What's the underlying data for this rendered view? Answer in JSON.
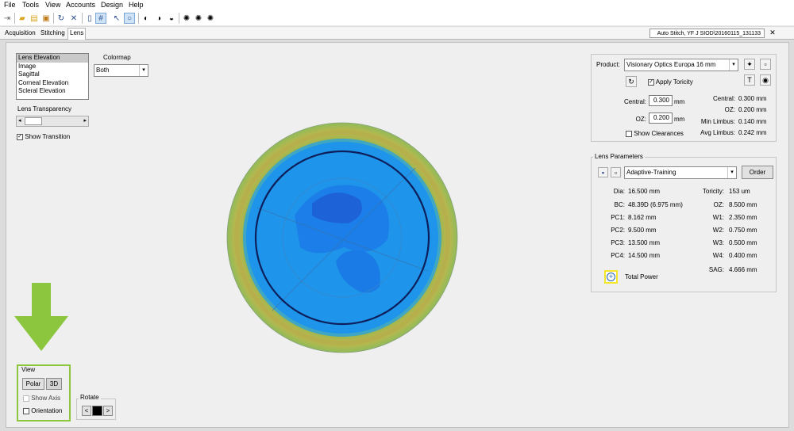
{
  "menu": [
    "File",
    "Tools",
    "View",
    "Accounts",
    "Design",
    "Help"
  ],
  "tabs": [
    "Acquisition",
    "Stitching",
    "Lens"
  ],
  "file_tab": "Auto Stitch, YF J SIOD\\20160115_131133",
  "display_list": [
    "Lens Elevation",
    "Image",
    "Sagittal",
    "Corneal Elevation",
    "Scleral Elevation"
  ],
  "colormap": {
    "label": "Colormap",
    "value": "Both"
  },
  "transparency_label": "Lens Transparency",
  "show_transition": "Show Transition",
  "product": {
    "label": "Product:",
    "value": "Visionary Optics Europa 16 mm",
    "apply_toricity": "Apply Toricity",
    "central_label": "Central:",
    "central_value": "0.300",
    "oz_label": "OZ:",
    "oz_value": "0.200",
    "unit": "mm",
    "show_clearances": "Show Clearances",
    "stats": [
      {
        "label": "Central:",
        "value": "0.300 mm"
      },
      {
        "label": "OZ:",
        "value": "0.200 mm"
      },
      {
        "label": "Min Limbus:",
        "value": "0.140 mm"
      },
      {
        "label": "Avg Limbus:",
        "value": "0.242 mm"
      }
    ]
  },
  "lens_params": {
    "title": "Lens Parameters",
    "design": "Adaptive-Training",
    "order": "Order",
    "left": [
      {
        "label": "Dia:",
        "value": "16.500 mm"
      },
      {
        "label": "BC:",
        "value": "48.39D (6.975 mm)"
      },
      {
        "label": "PC1:",
        "value": "8.162 mm"
      },
      {
        "label": "PC2:",
        "value": "9.500 mm"
      },
      {
        "label": "PC3:",
        "value": "13.500 mm"
      },
      {
        "label": "PC4:",
        "value": "14.500 mm"
      }
    ],
    "right": [
      {
        "label": "Toricity:",
        "value": "153 um"
      },
      {
        "label": "OZ:",
        "value": "8.500 mm"
      },
      {
        "label": "W1:",
        "value": "2.350 mm"
      },
      {
        "label": "W2:",
        "value": "0.750 mm"
      },
      {
        "label": "W3:",
        "value": "0.500 mm"
      },
      {
        "label": "W4:",
        "value": "0.400 mm"
      },
      {
        "label": "SAG:",
        "value": "4.666 mm"
      }
    ],
    "total_power": "Total Power"
  },
  "view": {
    "title": "View",
    "polar": "Polar",
    "threed": "3D",
    "show_axis": "Show Axis",
    "orientation": "Orientation"
  },
  "rotate": {
    "title": "Rotate",
    "prev": "<",
    "next": ">"
  },
  "colors": {
    "accent": "#8cc63f",
    "lens_blue": "#1f8fe6",
    "lens_dark_blue": "#1a5fd6",
    "ring_olive": "#b8b64a",
    "ring_green": "#7fb06a",
    "highlight": "#f5e62a"
  }
}
